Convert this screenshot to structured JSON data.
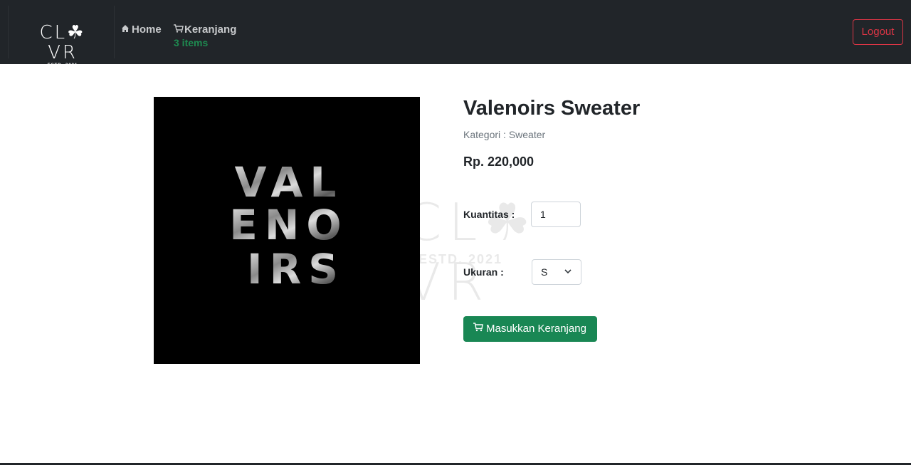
{
  "brand": {
    "name": "CL☘VR",
    "tagline": "ESTD. 2021"
  },
  "nav": {
    "home_label": "Home",
    "cart_label": "Keranjang",
    "cart_count": "3 items",
    "logout_label": "Logout"
  },
  "product": {
    "image_text": [
      "VAL",
      "ENO",
      "IRS"
    ],
    "name": "Valenoirs Sweater",
    "category": "Kategori : Sweater",
    "price": "Rp. 220,000",
    "quantity_label": "Kuantitas :",
    "quantity_value": "1",
    "size_label": "Ukuran :",
    "size_value": "S",
    "add_to_cart_label": "Masukkan Keranjang"
  },
  "watermark": {
    "word": "CL☘VR",
    "sub": "ESTD. 2021"
  },
  "colors": {
    "navbar": "#212529",
    "accent_green": "#198754",
    "logout_red": "#dc3545"
  },
  "icons": [
    "home-icon",
    "cart-icon",
    "chevron-down-icon"
  ]
}
